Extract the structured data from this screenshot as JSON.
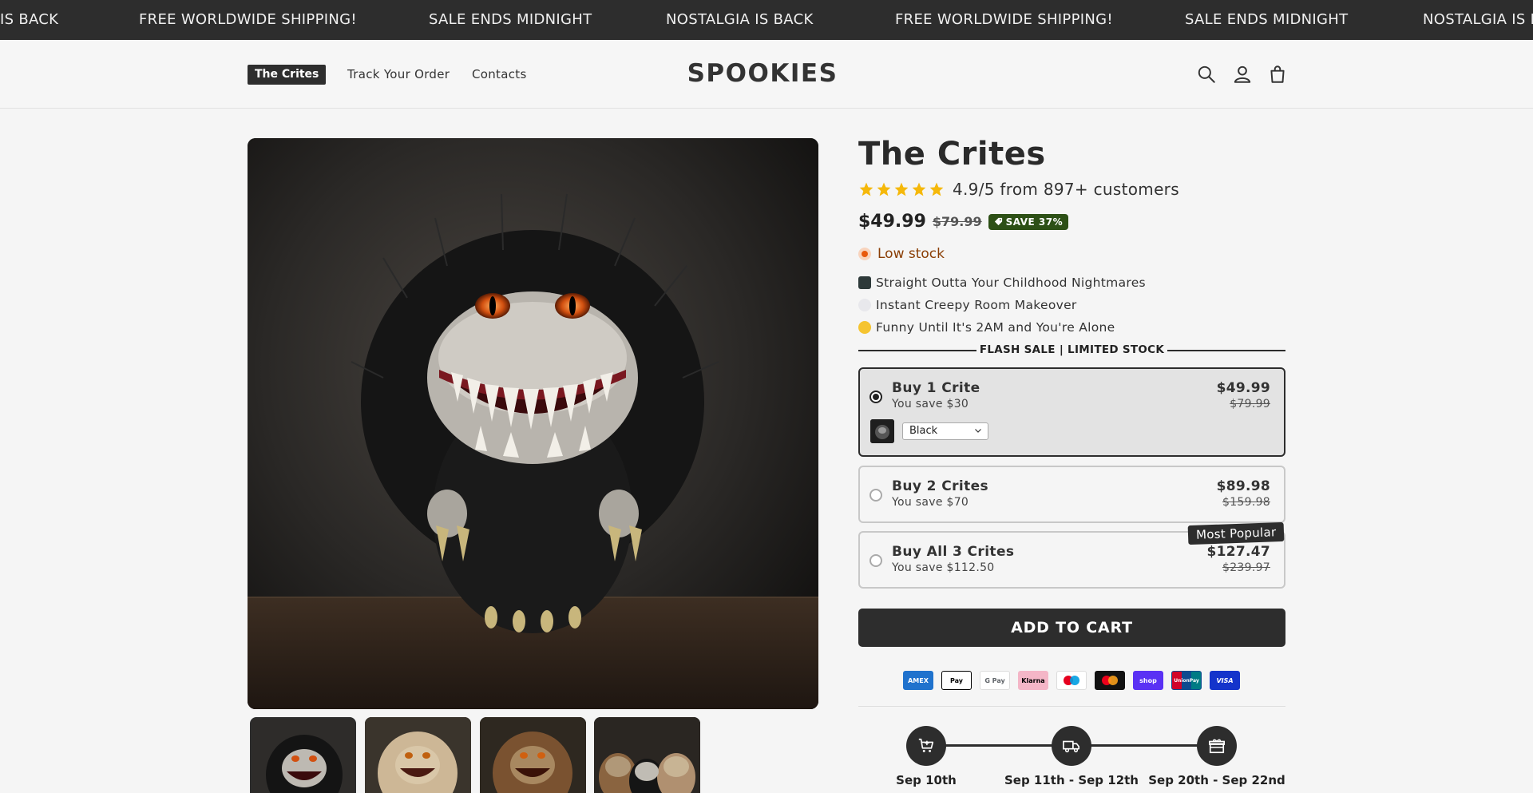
{
  "announcement": {
    "items": [
      "IS BACK",
      "FREE WORLDWIDE SHIPPING!",
      "SALE ENDS MIDNIGHT",
      "NOSTALGIA IS BACK",
      "FREE WORLDWIDE SHIPPING!",
      "SALE ENDS MIDNIGHT",
      "NOSTALGIA IS BA"
    ]
  },
  "header": {
    "nav": [
      "The Crites",
      "Track Your Order",
      "Contacts"
    ],
    "logo": "SPOOKIES",
    "icons": [
      "search-icon",
      "account-icon",
      "cart-icon"
    ]
  },
  "product": {
    "title": "The Crites",
    "rating_text": "4.9/5 from 897+ customers",
    "stars": 5,
    "price": "$49.99",
    "compare_price": "$79.99",
    "save_badge": "SAVE 37%",
    "stock": "Low stock",
    "features": [
      "Straight Outta Your Childhood Nightmares",
      "Instant Creepy Room Makeover",
      "Funny Until It's 2AM and You're Alone"
    ],
    "flash_title": "FLASH SALE | LIMITED STOCK",
    "offers": [
      {
        "title": "Buy 1 Crite",
        "save": "You save $30",
        "price": "$49.99",
        "compare": "$79.99"
      },
      {
        "title": "Buy 2 Crites",
        "save": "You save $70",
        "price": "$89.98",
        "compare": "$159.98"
      },
      {
        "title": "Buy All 3 Crites",
        "save": "You save $112.50",
        "price": "$127.47",
        "compare": "$239.97"
      }
    ],
    "variant": "Black",
    "popular_badge": "Most Popular",
    "add_to_cart": "ADD TO CART",
    "payments": [
      "AMEX",
      "Pay",
      "G Pay",
      "Klarna",
      "",
      "",
      "shop",
      "UnionPay",
      "VISA"
    ],
    "shipping_steps": [
      "Sep 10th",
      "Sep 11th - Sep 12th",
      "Sep 20th - Sep 22nd"
    ]
  },
  "colors": {
    "dark": "#2d2d2d",
    "save_green": "#2d5016",
    "stock_orange": "#e8590c",
    "star": "#f5b80a"
  }
}
